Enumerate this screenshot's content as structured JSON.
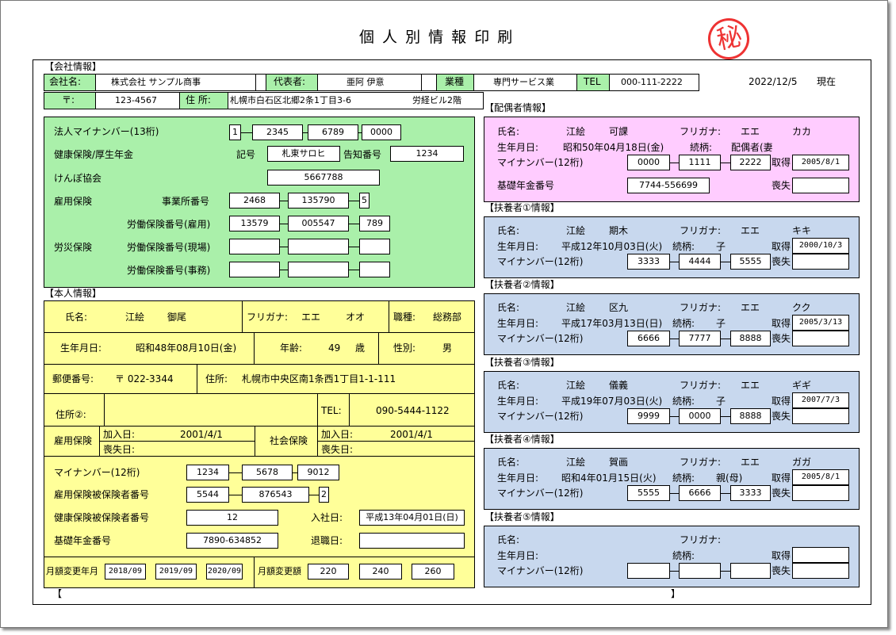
{
  "title": "個 人 別 情 報 印 刷",
  "seal_text": "秘",
  "date": "2022/12/5",
  "date_suffix": "現在",
  "company": {
    "section": "【会社情報】",
    "name_label": "会社名:",
    "name": "株式会社 サンプル商事",
    "rep_label": "代表者:",
    "rep": "亜阿 伊意",
    "industry_label": "業種",
    "industry": "専門サービス業",
    "tel_label": "TEL",
    "tel": "000-111-2222",
    "zip_label": "〒:",
    "zip": "123-4567",
    "addr_label": "住 所:",
    "addr1": "札幌市白石区北郷2条1丁目3-6",
    "addr2": "労経ビル2階",
    "mynumber_label": "法人マイナンバー(13桁)",
    "mynumber": [
      "1",
      "2345",
      "6789",
      "0000"
    ],
    "kenpo_label": "健康保険/厚生年金",
    "kigou_label": "記号",
    "kigou": "札東サロヒ",
    "kokuchi_label": "告知番号",
    "kokuchi": "1234",
    "kyokai_label": "けんぽ協会",
    "kyokai": "5667788",
    "koyou_label": "雇用保険",
    "jigyosho_label": "事業所番号",
    "jigyosho": [
      "2468",
      "135790",
      "5"
    ],
    "rodo_koyou_label": "労働保険番号(雇用)",
    "rodo_koyou": [
      "13579",
      "005547",
      "789"
    ],
    "rousai_label": "労災保険",
    "rodo_genba_label": "労働保険番号(現場)",
    "rodo_jimu_label": "労働保険番号(事務)"
  },
  "person": {
    "section": "【本人情報】",
    "name_label": "氏名:",
    "name_last": "江絵",
    "name_first": "御尾",
    "furigana_label": "フリガナ:",
    "furi_last": "エエ",
    "furi_first": "オオ",
    "job_label": "職種:",
    "job": "総務部",
    "birth_label": "生年月日:",
    "birth": "昭和48年08月10日(金)",
    "age_label": "年齢:",
    "age": "49",
    "age_unit": "歳",
    "sex_label": "性別:",
    "sex": "男",
    "zip_label": "郵便番号:",
    "zip": "〒 022-3344",
    "addr_label": "住所:",
    "addr": "札幌市中央区南1条西1丁目1-1-111",
    "addr2_label": "住所②:",
    "tel_label": "TEL:",
    "tel": "090-5444-1122",
    "koyou_label": "雇用保険",
    "join_label": "加入日:",
    "koyou_join": "2001/4/1",
    "lose_label": "喪失日:",
    "shakai_label": "社会保険",
    "shakai_join": "2001/4/1",
    "mynumber_label": "マイナンバー(12桁)",
    "mynumber": [
      "1234",
      "5678",
      "9012"
    ],
    "koyou_no_label": "雇用保険被保険者番号",
    "koyou_no": [
      "5544",
      "876543",
      "2"
    ],
    "kenpo_no_label": "健康保険被保険者番号",
    "kenpo_no": "12",
    "nyusha_label": "入社日:",
    "nyusha": "平成13年04月01日(日)",
    "nenkin_label": "基礎年金番号",
    "nenkin": "7890-634852",
    "taishoku_label": "退職日:",
    "getsugaku_ym_label": "月額変更年月",
    "getsugaku_ym": [
      "2018/09",
      "2019/09",
      "2020/09"
    ],
    "getsugaku_label": "月額変更額",
    "getsugaku": [
      "220",
      "240",
      "260"
    ]
  },
  "spouse": {
    "section": "【配偶者情報】",
    "name_label": "氏名:",
    "name_last": "江絵",
    "name_first": "可課",
    "furigana_label": "フリガナ:",
    "furi_last": "エエ",
    "furi_first": "カカ",
    "birth_label": "生年月日:",
    "birth": "昭和50年04月18日(金)",
    "rel_label": "続柄:",
    "rel": "配偶者(妻",
    "mynumber_label": "マイナンバー(12桁)",
    "mynumber": [
      "0000",
      "1111",
      "2222"
    ],
    "get_label": "取得",
    "get": "2005/8/1",
    "nenkin_label": "基礎年金番号",
    "nenkin": "7744-556699",
    "lose_label": "喪失"
  },
  "dependents": [
    {
      "section": "【扶養者①情報】",
      "name_last": "江絵",
      "name_first": "期木",
      "furi_last": "エエ",
      "furi_first": "キキ",
      "birth": "平成12年10月03日(火)",
      "rel": "子",
      "mynumber": [
        "3333",
        "4444",
        "5555"
      ],
      "get": "2000/10/3"
    },
    {
      "section": "【扶養者②情報】",
      "name_last": "江絵",
      "name_first": "区九",
      "furi_last": "エエ",
      "furi_first": "クク",
      "birth": "平成17年03月13日(日)",
      "rel": "子",
      "mynumber": [
        "6666",
        "7777",
        "8888"
      ],
      "get": "2005/3/13"
    },
    {
      "section": "【扶養者③情報】",
      "name_last": "江絵",
      "name_first": "儀義",
      "furi_last": "エエ",
      "furi_first": "ギギ",
      "birth": "平成19年07月03日(火)",
      "rel": "子",
      "mynumber": [
        "9999",
        "0000",
        "8888"
      ],
      "get": "2007/7/3"
    },
    {
      "section": "【扶養者④情報】",
      "name_last": "江絵",
      "name_first": "賀画",
      "furi_last": "エエ",
      "furi_first": "ガガ",
      "birth": "昭和4年01月15日(火)",
      "rel": "親(母)",
      "mynumber": [
        "5555",
        "6666",
        "3333"
      ],
      "get": "2005/8/1"
    },
    {
      "section": "【扶養者⑤情報】",
      "name_last": "",
      "name_first": "",
      "furi_last": "",
      "furi_first": "",
      "birth": "",
      "rel": "",
      "mynumber": [
        "",
        "",
        ""
      ],
      "get": ""
    }
  ],
  "dep_labels": {
    "name": "氏名:",
    "furigana": "フリガナ:",
    "birth": "生年月日:",
    "rel": "続柄:",
    "mynumber": "マイナンバー(12桁)",
    "get": "取得",
    "lose": "喪失"
  },
  "footer": {
    "open": "【",
    "close": "】"
  }
}
